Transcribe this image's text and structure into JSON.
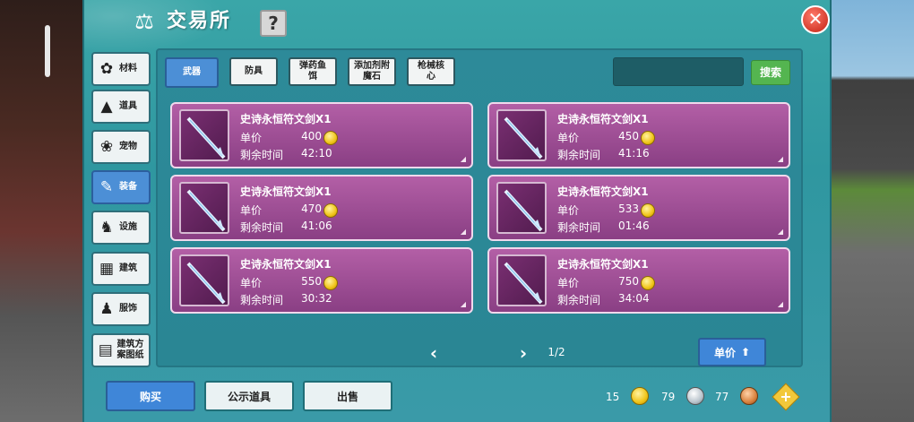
{
  "window": {
    "title": "交易所",
    "help_label": "?",
    "close_label": "✕"
  },
  "sidebar": {
    "items": [
      {
        "label": "材料",
        "icon": "materials-icon"
      },
      {
        "label": "道具",
        "icon": "props-icon"
      },
      {
        "label": "宠物",
        "icon": "paw-icon"
      },
      {
        "label": "装备",
        "icon": "equipment-icon",
        "active": true
      },
      {
        "label": "设施",
        "icon": "facility-icon"
      },
      {
        "label": "建筑",
        "icon": "brick-icon"
      },
      {
        "label": "服饰",
        "icon": "clothing-icon"
      },
      {
        "label": "建筑方案图纸",
        "icon": "blueprint-icon"
      }
    ]
  },
  "tabs": [
    {
      "label": "武器",
      "active": true
    },
    {
      "label": "防具"
    },
    {
      "label": "弹药鱼饵"
    },
    {
      "label": "添加剂附魔石"
    },
    {
      "label": "枪械核心"
    }
  ],
  "search": {
    "value": "",
    "button_label": "搜索"
  },
  "items": [
    {
      "name": "史诗永恒符文剑X1",
      "price_label": "单价",
      "price": "400",
      "time_label": "剩余时间",
      "time": "42:10"
    },
    {
      "name": "史诗永恒符文剑X1",
      "price_label": "单价",
      "price": "450",
      "time_label": "剩余时间",
      "time": "41:16"
    },
    {
      "name": "史诗永恒符文剑X1",
      "price_label": "单价",
      "price": "470",
      "time_label": "剩余时间",
      "time": "41:06"
    },
    {
      "name": "史诗永恒符文剑X1",
      "price_label": "单价",
      "price": "533",
      "time_label": "剩余时间",
      "time": "01:46"
    },
    {
      "name": "史诗永恒符文剑X1",
      "price_label": "单价",
      "price": "550",
      "time_label": "剩余时间",
      "time": "30:32"
    },
    {
      "name": "史诗永恒符文剑X1",
      "price_label": "单价",
      "price": "750",
      "time_label": "剩余时间",
      "time": "34:04"
    }
  ],
  "pagination": {
    "current": "1/2",
    "prev": "‹",
    "next": "›"
  },
  "sort": {
    "label": "单价",
    "icon": "sort-arrow-icon"
  },
  "bottom": {
    "buy_label": "购买",
    "publicity_label": "公示道具",
    "sell_label": "出售"
  },
  "currency": {
    "gold": "15",
    "silver": "79",
    "bronze": "77",
    "add_label": "+"
  },
  "colors": {
    "panel": "#3aa6a8",
    "card": "#b35fa6",
    "active_tab": "#4c8fd6",
    "search_button": "#54b550",
    "close_button": "#d53b2c"
  }
}
